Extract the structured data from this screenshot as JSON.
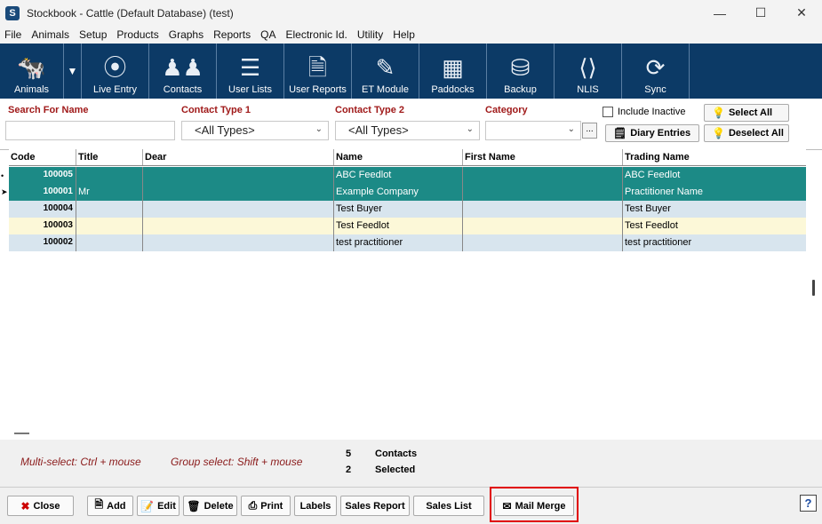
{
  "window": {
    "title": "Stockbook - Cattle (Default Database) (test)"
  },
  "menu": [
    "File",
    "Animals",
    "Setup",
    "Products",
    "Graphs",
    "Reports",
    "QA",
    "Electronic Id.",
    "Utility",
    "Help"
  ],
  "toolbar": {
    "animals": "Animals",
    "live_entry": "Live Entry",
    "contacts": "Contacts",
    "user_lists": "User Lists",
    "user_reports": "User Reports",
    "et_module": "ET Module",
    "paddocks": "Paddocks",
    "backup": "Backup",
    "nlis": "NLIS",
    "sync": "Sync"
  },
  "filters": {
    "search_label": "Search For Name",
    "search_value": "",
    "contact_type1_label": "Contact Type 1",
    "contact_type1_value": "<All Types>",
    "contact_type2_label": "Contact Type 2",
    "contact_type2_value": "<All Types>",
    "category_label": "Category",
    "category_value": "",
    "dots": "...",
    "include_inactive": "Include Inactive",
    "select_all": "Select All",
    "diary_entries": "Diary Entries",
    "deselect_all": "Deselect All"
  },
  "grid": {
    "columns": [
      "Code",
      "Title",
      "Dear",
      "Name",
      "First Name",
      "Trading Name"
    ],
    "rows": [
      {
        "code": "100005",
        "title": "",
        "dear": "",
        "name": "ABC Feedlot",
        "first_name": "",
        "trading_name": "ABC Feedlot",
        "style": "sel",
        "marker": "•"
      },
      {
        "code": "100001",
        "title": "Mr",
        "dear": "",
        "name": "Example Company",
        "first_name": "",
        "trading_name": "Practitioner Name",
        "style": "sel",
        "marker": "➤"
      },
      {
        "code": "100004",
        "title": "",
        "dear": "",
        "name": "Test Buyer",
        "first_name": "",
        "trading_name": "Test Buyer",
        "style": "blue",
        "marker": ""
      },
      {
        "code": "100003",
        "title": "",
        "dear": "",
        "name": "Test Feedlot",
        "first_name": "",
        "trading_name": "Test Feedlot",
        "style": "yellow",
        "marker": ""
      },
      {
        "code": "100002",
        "title": "",
        "dear": "",
        "name": "test practitioner",
        "first_name": "",
        "trading_name": "test practitioner",
        "style": "blue",
        "marker": ""
      }
    ]
  },
  "status": {
    "multi_select": "Multi-select: Ctrl + mouse",
    "group_select": "Group select: Shift + mouse",
    "contacts_count": "5",
    "contacts_label": "Contacts",
    "selected_count": "2",
    "selected_label": "Selected"
  },
  "buttons": {
    "close": "Close",
    "add": "Add",
    "edit": "Edit",
    "delete": "Delete",
    "print": "Print",
    "labels": "Labels",
    "sales_report": "Sales Report",
    "sales_list": "Sales List",
    "mail_merge": "Mail Merge",
    "help": "?"
  },
  "colors": {
    "toolbar_bg": "#0c3a66",
    "selected_row": "#1c8a86",
    "highlight": "#e00000",
    "label_red": "#a01a1a"
  }
}
